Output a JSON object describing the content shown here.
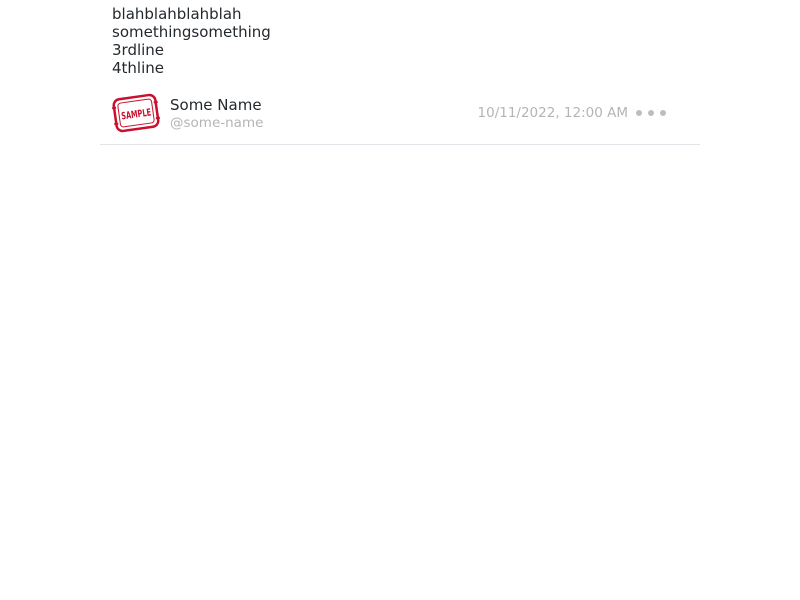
{
  "post": {
    "text_lines": [
      "blahblahblahblah",
      "somethingsomething",
      "3rdline",
      "4thline"
    ],
    "author": {
      "display_name": "Some Name",
      "handle": "@some-name",
      "avatar_text": "SAMPLE"
    },
    "timestamp": "10/11/2022, 12:00 AM",
    "more_icon": "more-horizontal-icon"
  },
  "colors": {
    "text": "#24292e",
    "muted": "#b5b5b5",
    "divider": "#e1e4e8",
    "stamp_red": "#c8102e"
  }
}
